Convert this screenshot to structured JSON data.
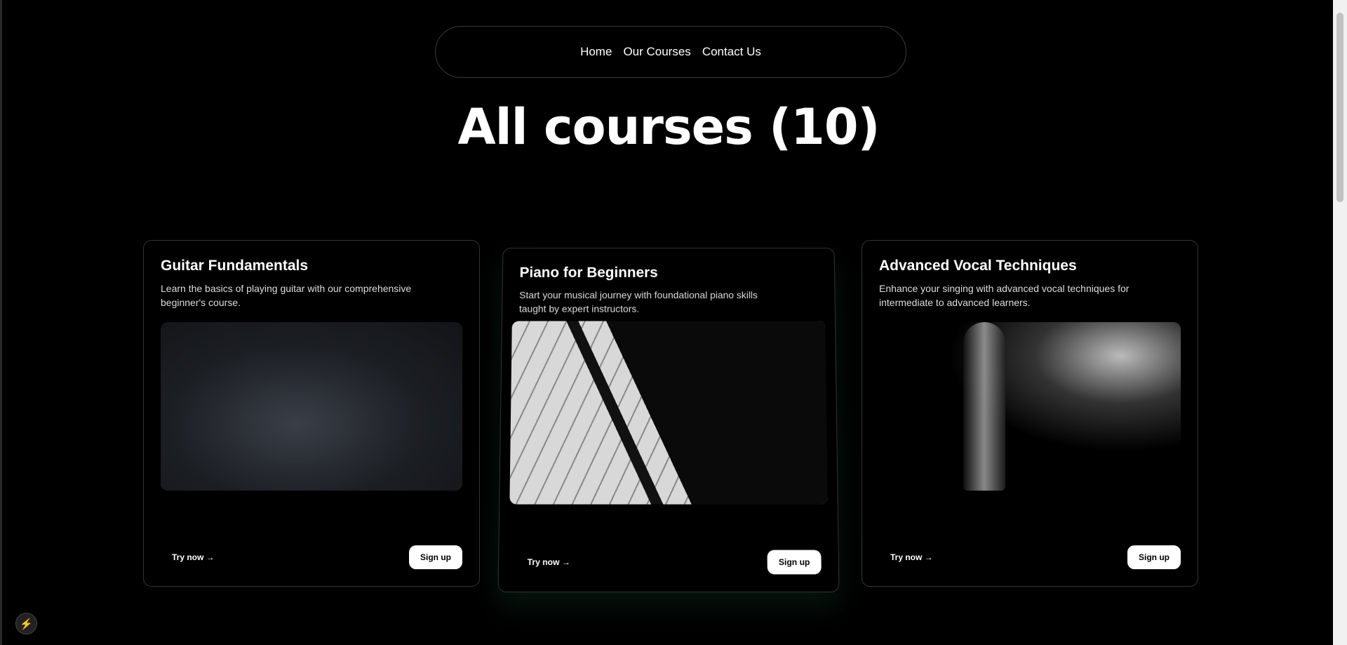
{
  "nav": {
    "items": [
      "Home",
      "Our Courses",
      "Contact Us"
    ]
  },
  "title": "All courses (10)",
  "courses": [
    {
      "title": "Guitar Fundamentals",
      "description": "Learn the basics of playing guitar with our comprehensive beginner's course.",
      "try": "Try now →",
      "signup": "Sign up"
    },
    {
      "title": "Piano for Beginners",
      "description": "Start your musical journey with foundational piano skills taught by expert instructors.",
      "try": "Try now →",
      "signup": "Sign up"
    },
    {
      "title": "Advanced Vocal Techniques",
      "description": "Enhance your singing with advanced vocal techniques for intermediate to advanced learners.",
      "try": "Try now →",
      "signup": "Sign up"
    }
  ],
  "dev_icon": "⚡"
}
